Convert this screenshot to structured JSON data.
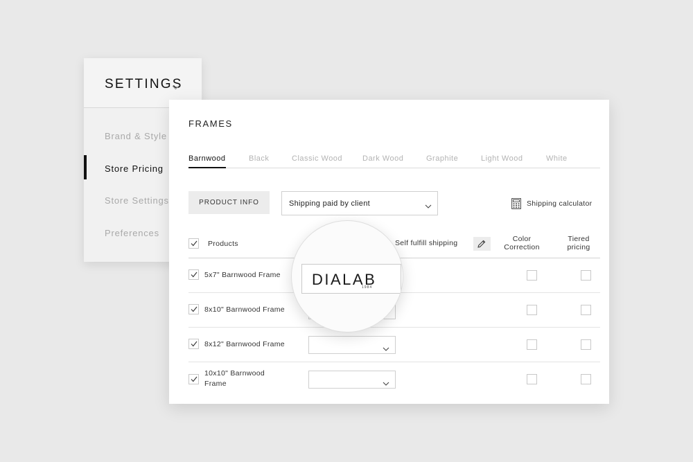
{
  "settings": {
    "title": "SETTINGS",
    "nav": [
      "Brand & Style",
      "Store Pricing",
      "Store Settings",
      "Preferences"
    ],
    "active_index": 1
  },
  "frames": {
    "title": "FRAMES",
    "tabs": [
      "Barnwood",
      "Black",
      "Classic Wood",
      "Dark Wood",
      "Graphite",
      "Light Wood",
      "White"
    ],
    "active_tab": "Barnwood",
    "product_info_button": "PRODUCT INFO",
    "shipping_select": "Shipping paid by client",
    "shipping_calculator": "Shipping calculator",
    "columns": {
      "products": "Products",
      "self_fulfill": "Self fulfill shipping",
      "color_correction": "Color Correction",
      "tiered_pricing": "Tiered pricing"
    },
    "rows": [
      {
        "label": "5x7\" Barnwood Frame",
        "checked": true
      },
      {
        "label": "8x10\" Barnwood Frame",
        "checked": true
      },
      {
        "label": "8x12\" Barnwood Frame",
        "checked": true
      },
      {
        "label": "10x10\" Barnwood Frame",
        "checked": true
      }
    ]
  },
  "magnifier": {
    "logo_text": "DIALAB",
    "logo_subtext": "1984"
  },
  "icons": {
    "settings_chevron": "chevron-down-icon",
    "calculator": "calculator-icon",
    "edit": "pencil-icon"
  }
}
